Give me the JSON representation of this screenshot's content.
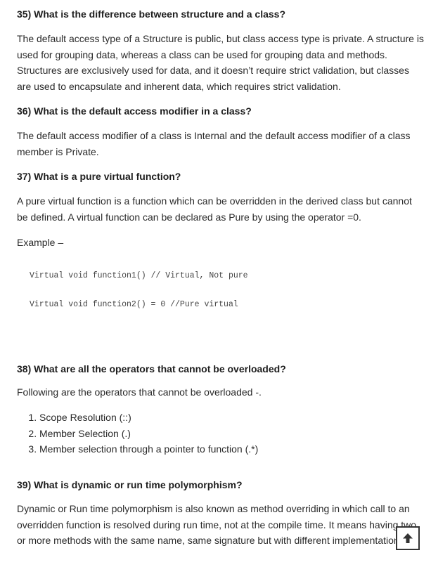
{
  "q35": {
    "title": "35) What is the difference between structure and a class?",
    "body": "The default access type of a Structure is public, but class access type is private. A structure is used for grouping data, whereas a class can be used for grouping data and methods. Structures are exclusively used for data, and it doesn’t require strict validation, but classes are used to encapsulate and inherent data, which requires strict validation."
  },
  "q36": {
    "title": "36) What is the default access modifier in a class?",
    "body": "The default access modifier of a class is Internal and the default access modifier of a class member is Private."
  },
  "q37": {
    "title": "37) What is a pure virtual function?",
    "body": "A pure virtual function is a function which can be overridden in the derived class but cannot be defined. A virtual function can be declared as Pure by using the operator =0.",
    "example_label": "Example –",
    "code": [
      "Virtual void function1() // Virtual, Not pure",
      "Virtual void function2() = 0 //Pure virtual"
    ]
  },
  "q38": {
    "title": "38) What are all the operators that cannot be overloaded?",
    "intro": "Following are the operators that cannot be overloaded -.",
    "items": [
      "Scope Resolution (::)",
      "Member Selection (.)",
      "Member selection through a pointer to function (.*)"
    ]
  },
  "q39": {
    "title": "39) What is dynamic or run time polymorphism?",
    "body": "Dynamic or Run time polymorphism is also known as method overriding in which call to an overridden function is resolved during run time, not at the compile time. It means having two or more methods with the same name, same signature but with different implementation."
  },
  "scroll_top": {
    "icon": "arrow-up-icon"
  }
}
